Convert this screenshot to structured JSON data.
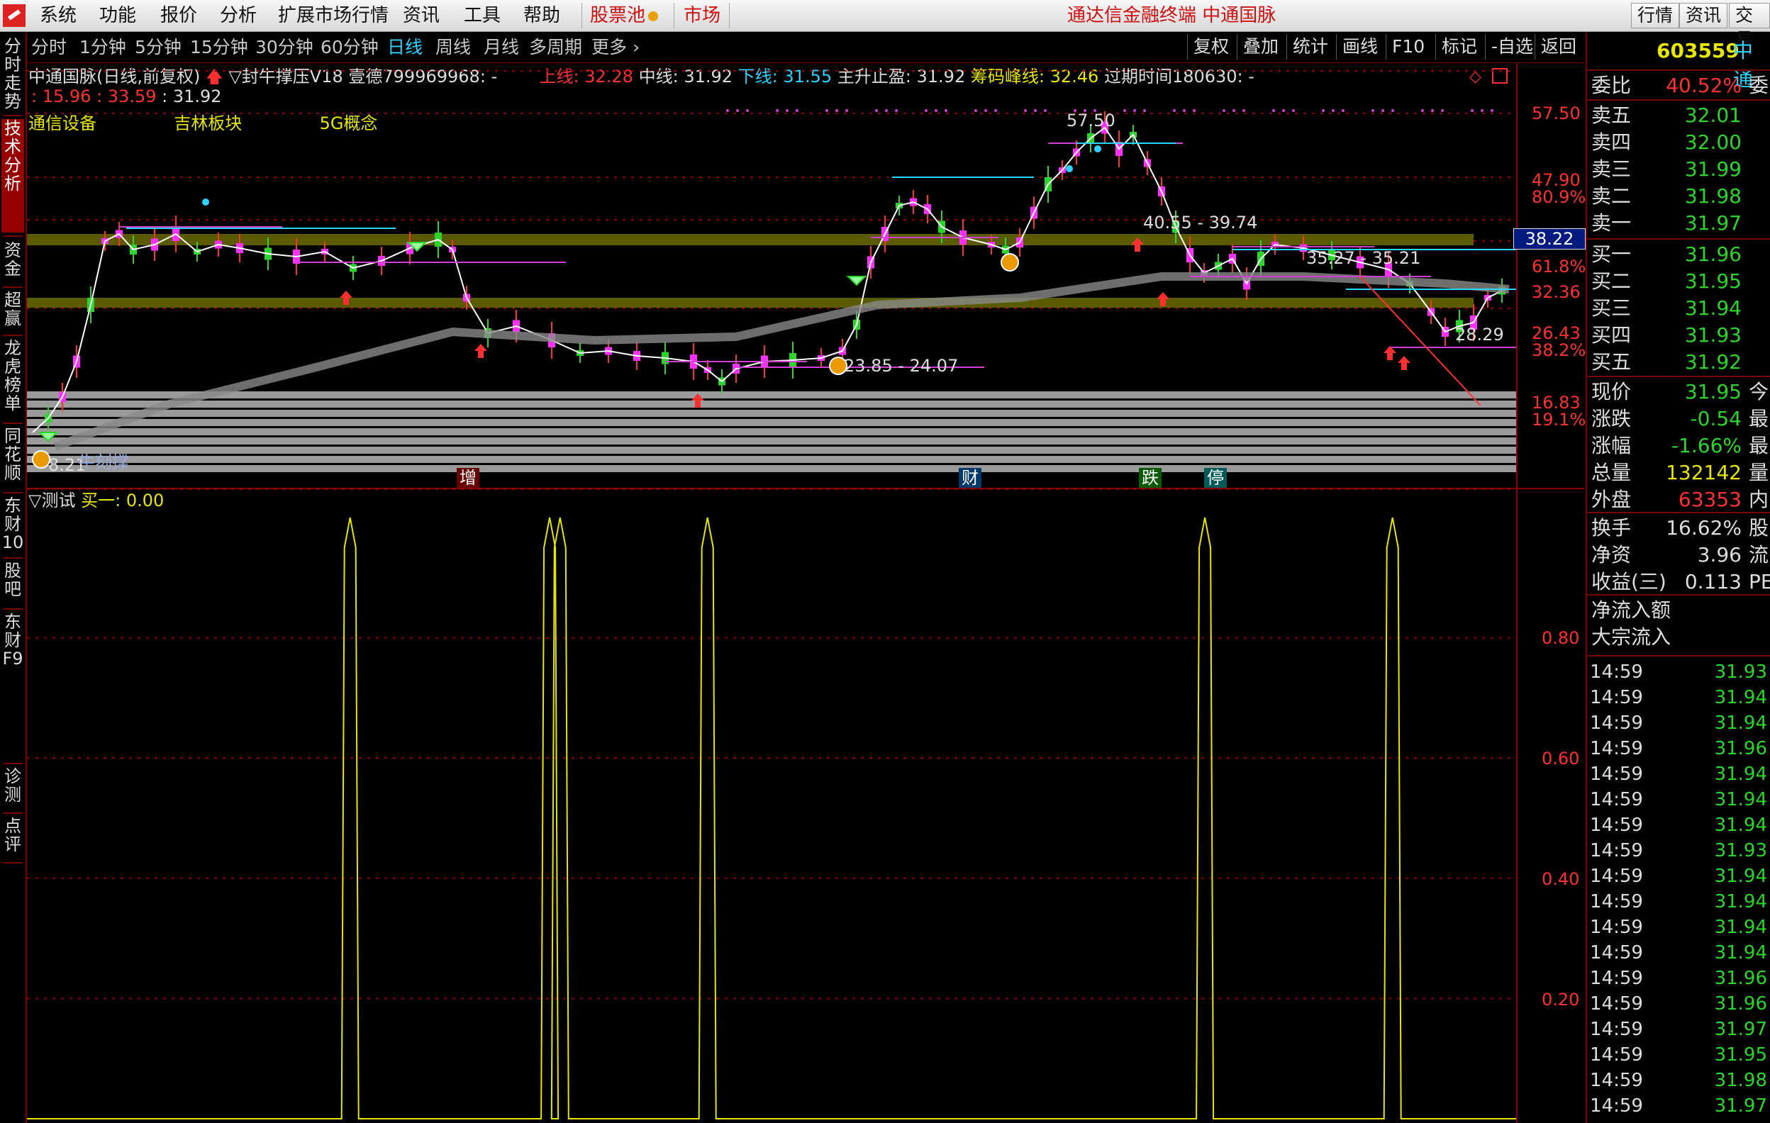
{
  "menu": {
    "items": [
      "系统",
      "功能",
      "报价",
      "分析",
      "扩展市场行情",
      "资讯",
      "工具",
      "帮助"
    ],
    "stock_pool": "股票池",
    "market": "市场",
    "title": "通达信金融终端  中通国脉",
    "right_buttons": [
      "行情",
      "资讯",
      "交易"
    ]
  },
  "left_tabs": [
    "分时走势",
    "技术分析",
    "资金",
    "超赢",
    "龙虎榜单",
    "同花顺",
    "东财10",
    "股吧",
    "东财F9",
    "诊测",
    "点评"
  ],
  "periods": [
    "分时",
    "1分钟",
    "5分钟",
    "15分钟",
    "30分钟",
    "60分钟",
    "日线",
    "周线",
    "月线",
    "多周期",
    "更多"
  ],
  "active_period": "日线",
  "tools": [
    "复权",
    "叠加",
    "统计",
    "画线",
    "F10",
    "标记",
    "-自选",
    "返回"
  ],
  "info": {
    "title": "中通国脉(日线,前复权)",
    "indicator": "▽封牛撑压V18",
    "extra": "壹德799969968: -",
    "upper_label": "上线:",
    "upper_val": "32.28",
    "mid_label": "中线:",
    "mid_val": "31.92",
    "lower_label": "下线:",
    "lower_val": "31.55",
    "stop_label": "主升止盈:",
    "stop_val": "31.92",
    "peak_label": "筹码峰线:",
    "peak_val": "32.46",
    "expire": "过期时间180630: -",
    "line2_a": ": 15.96",
    "line2_b": ": 33.59",
    "line2_c": ": 31.92",
    "sectors": [
      "通信设备",
      "吉林板块",
      "5G概念"
    ]
  },
  "price_axis": [
    "57.50",
    "47.90",
    "80.9%",
    "38.22",
    "61.8%",
    "32.36",
    "26.43",
    "38.2%",
    "16.83",
    "19.1%"
  ],
  "chart_labels": {
    "high": "57.50",
    "range1": "40.55 - 39.74",
    "range2": "35.27 - 35.21",
    "range3": "23.85 - 24.07",
    "low_price": "28.29",
    "start": "8.21",
    "start_note": "牛刻撑",
    "events": [
      "增",
      "财",
      "跌",
      "停"
    ]
  },
  "sub": {
    "name": "▽测试",
    "buy_label": "买一:",
    "buy_val": "0.00",
    "axis": [
      "0.80",
      "0.60",
      "0.40",
      "0.20"
    ]
  },
  "chart_data": [
    {
      "type": "line",
      "title": "▽测试",
      "ylim": [
        0,
        1
      ],
      "yticks": [
        0.2,
        0.4,
        0.6,
        0.8
      ],
      "series": [
        {
          "name": "买一",
          "color": "#e6e600",
          "peaks_x_fraction": [
            0.217,
            0.351,
            0.358,
            0.457,
            0.791,
            0.917
          ],
          "peak_value": 1.0
        }
      ]
    }
  ],
  "quote": {
    "code": "603559",
    "name": "中通",
    "weibi_label": "委比",
    "weibi_val": "40.52%",
    "weibi_tail": "委",
    "asks": [
      [
        "卖五",
        "32.01"
      ],
      [
        "卖四",
        "32.00"
      ],
      [
        "卖三",
        "31.99"
      ],
      [
        "卖二",
        "31.98"
      ],
      [
        "卖一",
        "31.97"
      ]
    ],
    "bids": [
      [
        "买一",
        "31.96"
      ],
      [
        "买二",
        "31.95"
      ],
      [
        "买三",
        "31.94"
      ],
      [
        "买四",
        "31.93"
      ],
      [
        "买五",
        "31.92"
      ]
    ],
    "stats1": [
      [
        "现价",
        "31.95",
        "今"
      ],
      [
        "涨跌",
        "-0.54",
        "最"
      ],
      [
        "涨幅",
        "-1.66%",
        "最"
      ],
      [
        "总量",
        "132142",
        "量"
      ],
      [
        "外盘",
        "63353",
        "内"
      ]
    ],
    "stats2": [
      [
        "换手",
        "16.62%",
        "股"
      ],
      [
        "净资",
        "3.96",
        "流"
      ],
      [
        "收益(三)",
        "0.113",
        "PE"
      ]
    ],
    "flows": [
      "净流入额",
      "大宗流入"
    ],
    "ticks": [
      [
        "14:59",
        "31.93"
      ],
      [
        "14:59",
        "31.94"
      ],
      [
        "14:59",
        "31.94"
      ],
      [
        "14:59",
        "31.96"
      ],
      [
        "14:59",
        "31.94"
      ],
      [
        "14:59",
        "31.94"
      ],
      [
        "14:59",
        "31.94"
      ],
      [
        "14:59",
        "31.93"
      ],
      [
        "14:59",
        "31.94"
      ],
      [
        "14:59",
        "31.94"
      ],
      [
        "14:59",
        "31.94"
      ],
      [
        "14:59",
        "31.94"
      ],
      [
        "14:59",
        "31.96"
      ],
      [
        "14:59",
        "31.96"
      ],
      [
        "14:59",
        "31.97"
      ],
      [
        "14:59",
        "31.95"
      ],
      [
        "14:59",
        "31.98"
      ],
      [
        "14:59",
        "31.97"
      ]
    ]
  },
  "colors": {
    "red": "#ff3030",
    "green": "#2bd62b",
    "yellow": "#e6e600",
    "cyan": "#2ad4ff",
    "grid": "#8b0000"
  }
}
